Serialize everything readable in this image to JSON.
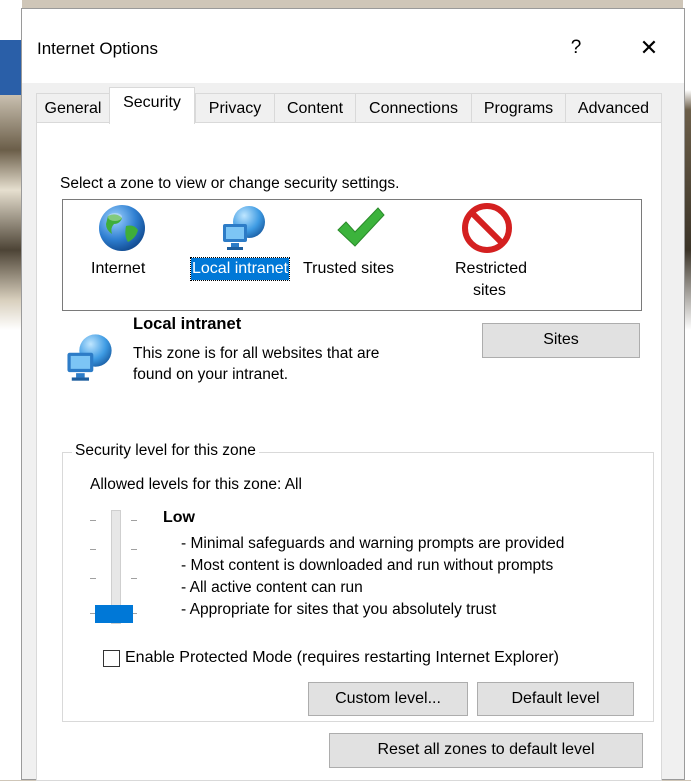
{
  "window": {
    "title": "Internet Options",
    "help_glyph": "?",
    "close_glyph": "✕"
  },
  "tabs": [
    {
      "label": "General"
    },
    {
      "label": "Security"
    },
    {
      "label": "Privacy"
    },
    {
      "label": "Content"
    },
    {
      "label": "Connections"
    },
    {
      "label": "Programs"
    },
    {
      "label": "Advanced"
    }
  ],
  "active_tab": "Security",
  "security": {
    "instruction": "Select a zone to view or change security settings.",
    "zones": [
      {
        "label": "Internet",
        "icon": "globe-icon"
      },
      {
        "label": "Local intranet",
        "icon": "network-globe-icon"
      },
      {
        "label": "Trusted sites",
        "icon": "checkmark-icon"
      },
      {
        "label_line1": "Restricted",
        "label_line2": "sites",
        "icon": "no-entry-icon"
      }
    ],
    "selected_zone": "Local intranet",
    "selected_zone_info": {
      "title": "Local intranet",
      "description_line1": "This zone is for all websites that are",
      "description_line2": "found on your intranet."
    },
    "sites_button": "Sites",
    "level_group": {
      "legend": "Security level for this zone",
      "allowed": "Allowed levels for this zone: All",
      "level_name": "Low",
      "slider_level_fraction": 0.0,
      "bullets": [
        "- Minimal safeguards and warning prompts are provided",
        "- Most content is downloaded and run without prompts",
        "- All active content can run",
        "- Appropriate for sites that you absolutely trust"
      ],
      "protected_mode_label": "Enable Protected Mode (requires restarting Internet Explorer)",
      "protected_mode_checked": false,
      "custom_level_button": "Custom level...",
      "default_level_button": "Default level"
    },
    "reset_all_button": "Reset all zones to default level"
  },
  "colors": {
    "selection": "#0078d7",
    "slider_thumb": "#0078d7",
    "dialog_bg": "#f0f0f0",
    "panel_bg": "#ffffff"
  }
}
